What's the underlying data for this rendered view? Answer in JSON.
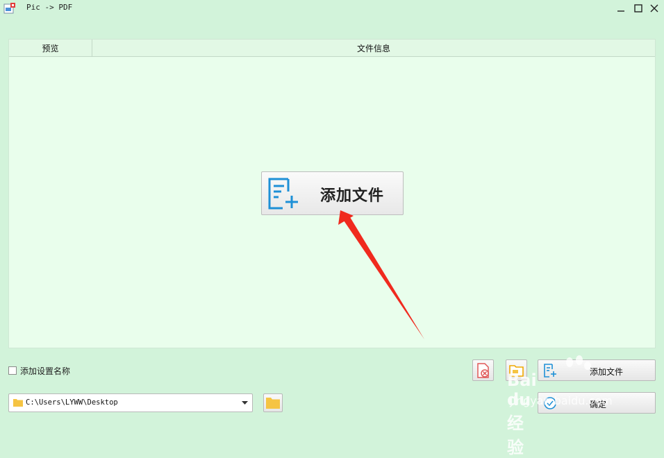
{
  "window": {
    "title": "Pic -> PDF"
  },
  "list": {
    "columns": [
      "预览",
      "文件信息"
    ]
  },
  "center_button": {
    "label": "添加文件"
  },
  "options": {
    "add_settings_name_label": "添加设置名称",
    "add_settings_name_checked": false
  },
  "output": {
    "path": "C:\\Users\\LYWW\\Desktop"
  },
  "actions": {
    "add_files_label": "添加文件",
    "confirm_label": "确定"
  },
  "watermark": {
    "brand": "Bai du 经验",
    "url": "jingyan.baidu.com"
  },
  "colors": {
    "background": "#d2f3da",
    "list_background": "#e9feec",
    "accent_blue": "#1e90d6",
    "arrow_red": "#f02a1e"
  }
}
